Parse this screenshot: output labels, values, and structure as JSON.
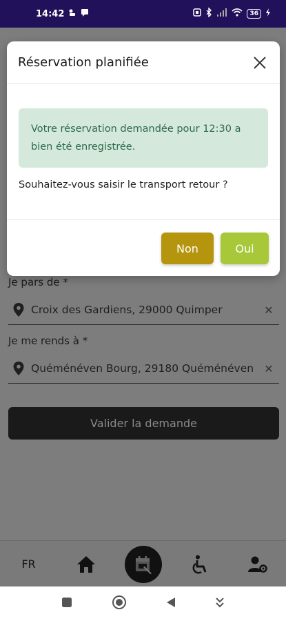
{
  "status_bar": {
    "time": "14:42",
    "battery": "36",
    "icons": [
      "notification-icon",
      "message-icon",
      "nfc-icon",
      "bluetooth-icon",
      "signal-icon",
      "wifi-icon",
      "battery-icon",
      "charging-icon"
    ]
  },
  "form": {
    "from_label": "Je pars de *",
    "from_value": "Croix des Gardiens, 29000 Quimper",
    "to_label": "Je me rends à *",
    "to_value": "Quéménéven Bourg, 29180 Quéménéven",
    "submit_label": "Valider la demande"
  },
  "dialog": {
    "title": "Réservation planifiée",
    "message": "Votre réservation demandée pour 12:30 a bien été enregistrée.",
    "question": "Souhaitez-vous saisir le transport retour ?",
    "no_label": "Non",
    "yes_label": "Oui"
  },
  "bottom_nav": {
    "lang": "FR",
    "items": [
      "home-icon",
      "calendar-edit-icon",
      "wheelchair-icon",
      "user-settings-icon"
    ]
  },
  "colors": {
    "status_bar": "#21105a",
    "alert_bg": "#d4e9dc",
    "alert_text": "#2d6a4a",
    "no_button": "#b5950d",
    "yes_button": "#a8c83a"
  }
}
